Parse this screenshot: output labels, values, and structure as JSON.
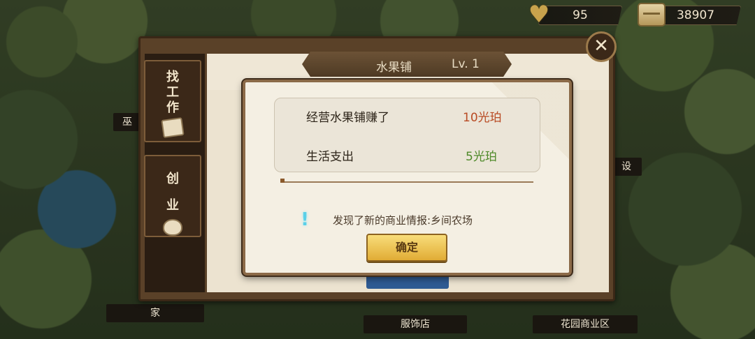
{
  "resources": {
    "heart_value": "95",
    "gold_value": "38907"
  },
  "side_tabs": {
    "job_chars": [
      "找",
      "工",
      "作"
    ],
    "business_chars": [
      "创",
      "业"
    ]
  },
  "shop": {
    "name": "水果铺",
    "level": "Lv.  1"
  },
  "map_labels": {
    "home": "家",
    "clothing": "服饰店",
    "garden": "花园商业区",
    "left_partial": "巫",
    "right_partial": "设"
  },
  "result": {
    "earn_label": "经营水果铺赚了",
    "earn_value": "10光珀",
    "spend_label": "生活支出",
    "spend_value": "5光珀",
    "info_text": "发现了新的商业情报:乡间农场",
    "confirm_label": "确定"
  },
  "colors": {
    "earn": "#b84a23",
    "spend": "#4f8a2a",
    "accent_gold": "#e1ac35"
  },
  "icons": [
    "heart-icon",
    "chest-icon",
    "close-icon",
    "job-ticket-icon",
    "money-bag-icon",
    "info-icon"
  ]
}
